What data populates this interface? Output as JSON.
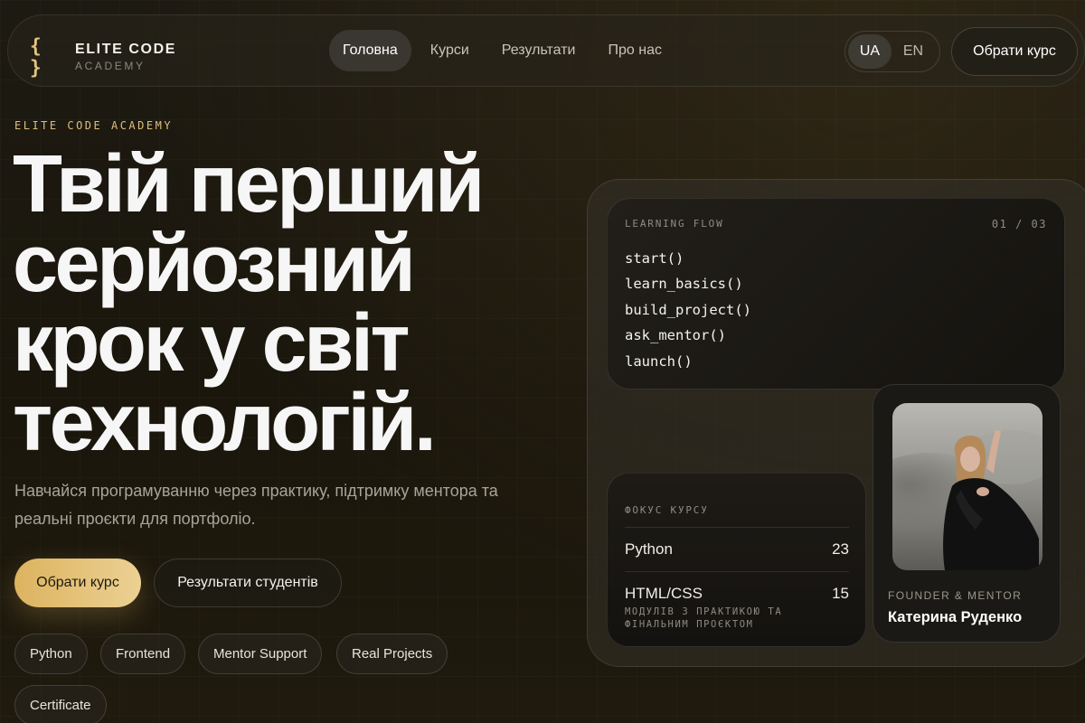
{
  "brand": {
    "icon": "{ }",
    "title": "ELITE CODE",
    "subtitle": "ACADEMY"
  },
  "nav": {
    "links": [
      {
        "label": "Головна",
        "active": true
      },
      {
        "label": "Курси",
        "active": false
      },
      {
        "label": "Результати",
        "active": false
      },
      {
        "label": "Про нас",
        "active": false
      }
    ],
    "languages": [
      {
        "label": "UA",
        "active": true
      },
      {
        "label": "EN",
        "active": false
      }
    ],
    "cta": "Обрати курс"
  },
  "hero": {
    "eyebrow": "ELITE CODE ACADEMY",
    "headline": [
      "Твій перший",
      "серйозний",
      "крок у світ",
      "технологій."
    ],
    "subtext": "Навчайся програмуванню через практику, підтримку ментора та реальні проєкти для портфоліо.",
    "primary_button": "Обрати курс",
    "secondary_button": "Результати студентів",
    "tags": [
      "Python",
      "Frontend",
      "Mentor Support",
      "Real Projects",
      "Certificate"
    ]
  },
  "learning_flow": {
    "label": "LEARNING FLOW",
    "step": "01 / 03",
    "lines": [
      "start()",
      "learn_basics()",
      "build_project()",
      "ask_mentor()",
      "launch()"
    ]
  },
  "course_focus": {
    "label": "ФОКУС КУРСУ",
    "rows": [
      {
        "name": "Python",
        "value": "23"
      },
      {
        "name": "HTML/CSS",
        "value": "15"
      }
    ],
    "note": "МОДУЛІВ З ПРАКТИКОЮ ТА ФІНАЛЬНИМ ПРОЄКТОМ"
  },
  "mentor": {
    "role": "FOUNDER & MENTOR",
    "name": "Катерина Руденко"
  },
  "colors": {
    "accent_gold": "#dcb35f",
    "accent_gold_light": "#ecd194",
    "background": "#1c1910"
  }
}
